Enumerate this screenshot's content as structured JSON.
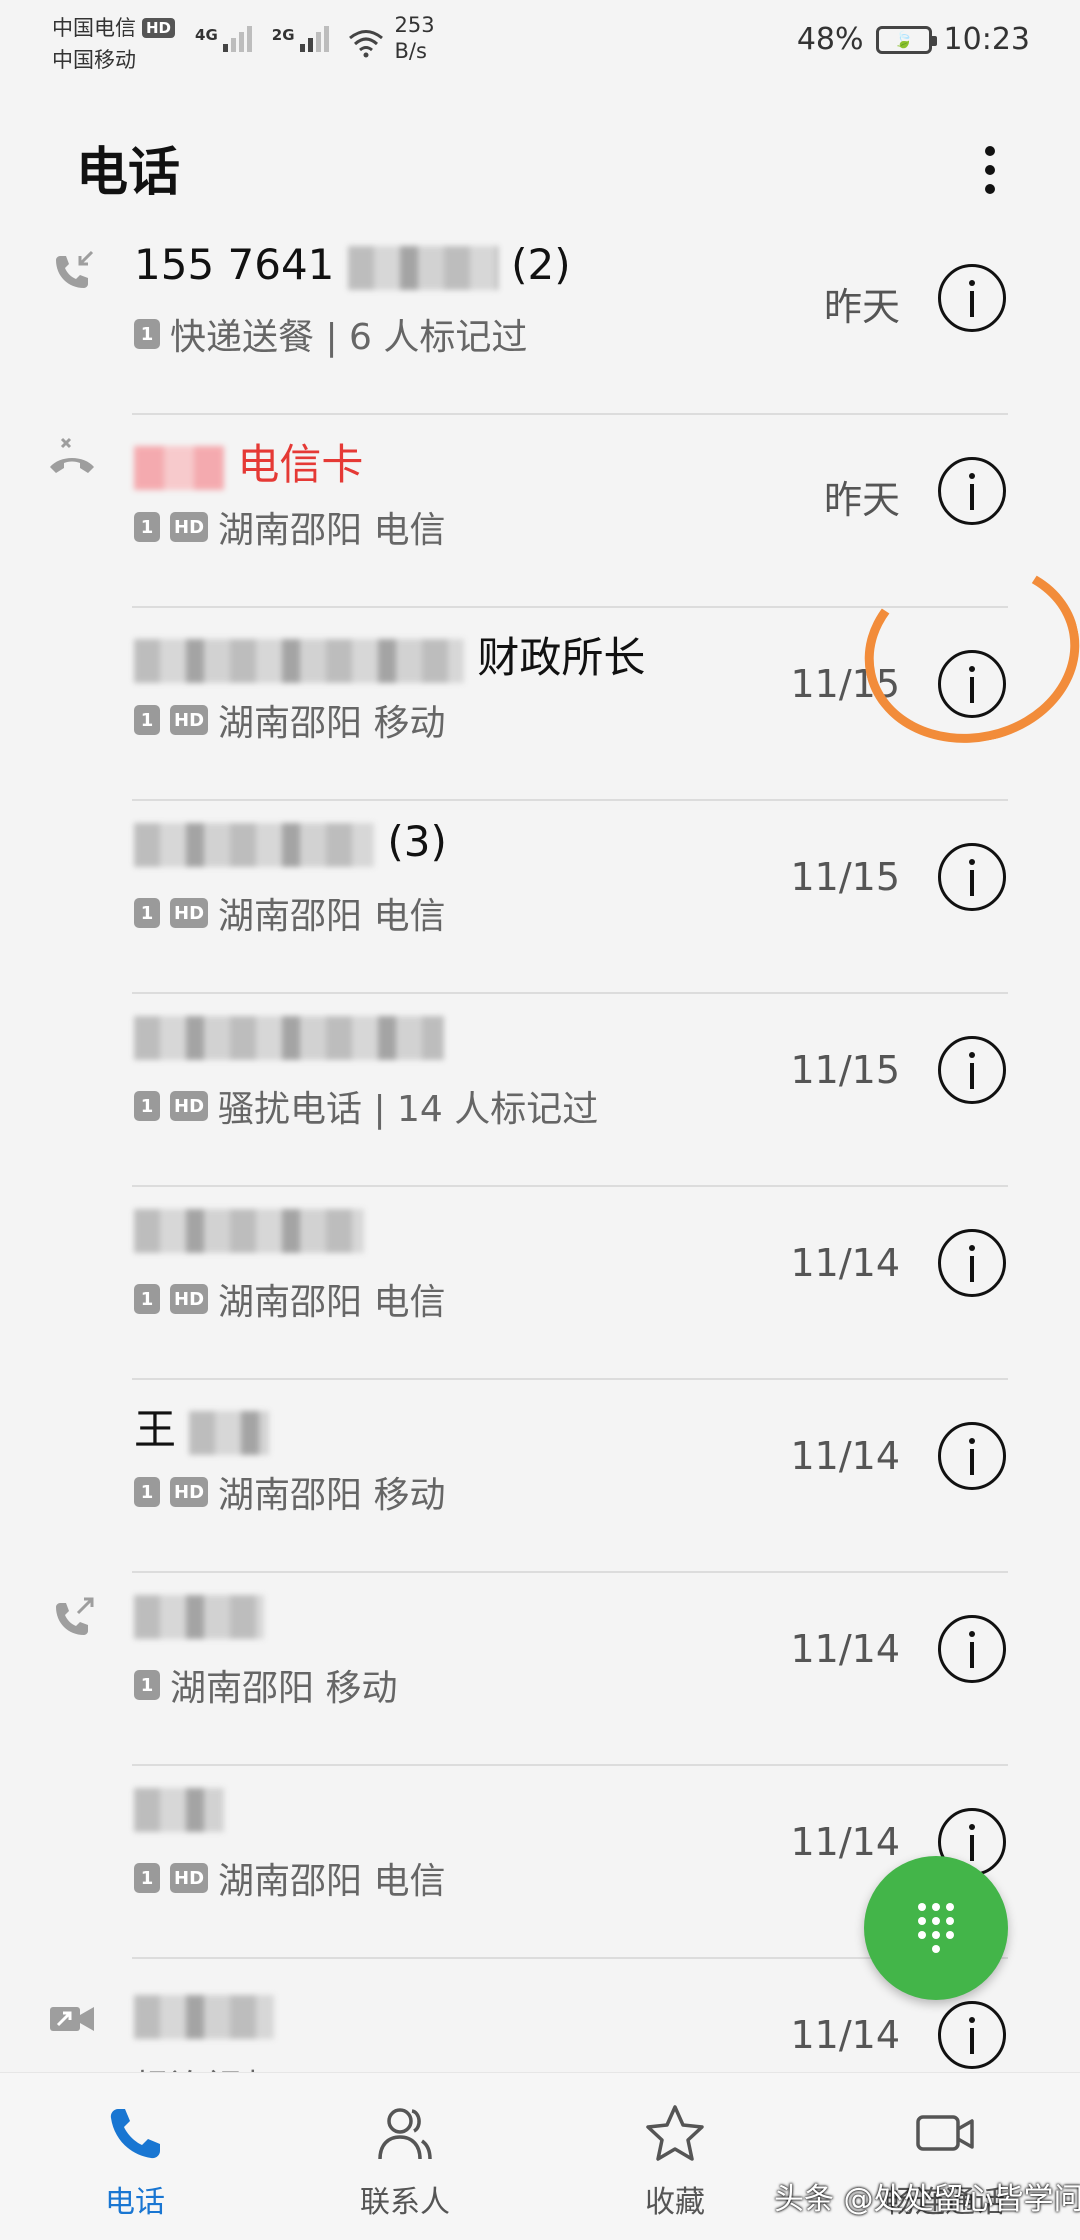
{
  "status_bar": {
    "carrier_1": "中国电信",
    "hd_badge": "HD",
    "carrier_2": "中国移动",
    "network_1": "4G",
    "network_2": "2G",
    "speed_value": "253",
    "speed_unit": "B/s",
    "battery": "48%",
    "time": "10:23"
  },
  "header": {
    "title": "电话"
  },
  "calls": [
    {
      "name_visible": "155 7641",
      "name_suffix": "(2)",
      "sim": "1",
      "hd": "",
      "subtitle": "快递送餐 | 6 人标记过",
      "date": "昨天",
      "type_icon": "incoming-call-icon",
      "missed": false
    },
    {
      "name_visible": "电信卡",
      "name_suffix": "",
      "sim": "1",
      "hd": "HD",
      "subtitle": "湖南邵阳 电信",
      "date": "昨天",
      "type_icon": "missed-call-icon",
      "missed": true
    },
    {
      "name_visible": "财政所长",
      "name_suffix": "",
      "sim": "1",
      "hd": "HD",
      "subtitle": "湖南邵阳 移动",
      "date": "11/15",
      "type_icon": "",
      "missed": false
    },
    {
      "name_visible": "",
      "name_suffix": "(3)",
      "sim": "1",
      "hd": "HD",
      "subtitle": "湖南邵阳 电信",
      "date": "11/15",
      "type_icon": "",
      "missed": false
    },
    {
      "name_visible": "",
      "name_suffix": "",
      "sim": "1",
      "hd": "HD",
      "subtitle": "骚扰电话 | 14 人标记过",
      "date": "11/15",
      "type_icon": "",
      "missed": false
    },
    {
      "name_visible": "",
      "name_suffix": "",
      "sim": "1",
      "hd": "HD",
      "subtitle": "湖南邵阳 电信",
      "date": "11/14",
      "type_icon": "",
      "missed": false
    },
    {
      "name_visible": "王",
      "name_suffix": "",
      "sim": "1",
      "hd": "HD",
      "subtitle": "湖南邵阳 移动",
      "date": "11/14",
      "type_icon": "",
      "missed": false
    },
    {
      "name_visible": "",
      "name_suffix": "",
      "sim": "1",
      "hd": "",
      "subtitle": "湖南邵阳 移动",
      "date": "11/14",
      "type_icon": "outgoing-call-icon",
      "missed": false
    },
    {
      "name_visible": "",
      "name_suffix": "",
      "sim": "1",
      "hd": "HD",
      "subtitle": "湖南邵阳 电信",
      "date": "11/14",
      "type_icon": "",
      "missed": false
    },
    {
      "name_visible": "",
      "name_suffix": "",
      "sim": "",
      "hd": "",
      "subtitle": "畅连视频",
      "date": "11/14",
      "type_icon": "video-call-icon",
      "missed": false
    }
  ],
  "bottom_nav": [
    {
      "label": "电话",
      "icon": "phone-icon",
      "active": true
    },
    {
      "label": "联系人",
      "icon": "contacts-icon",
      "active": false
    },
    {
      "label": "收藏",
      "icon": "star-icon",
      "active": false
    },
    {
      "label": "畅连通话",
      "icon": "video-call-icon",
      "active": false
    }
  ],
  "watermark": "头条 @处处留心皆学问",
  "colors": {
    "accent": "#1976d2",
    "missed": "#e53935",
    "fab": "#43b549",
    "annotation": "#f28c3a"
  }
}
